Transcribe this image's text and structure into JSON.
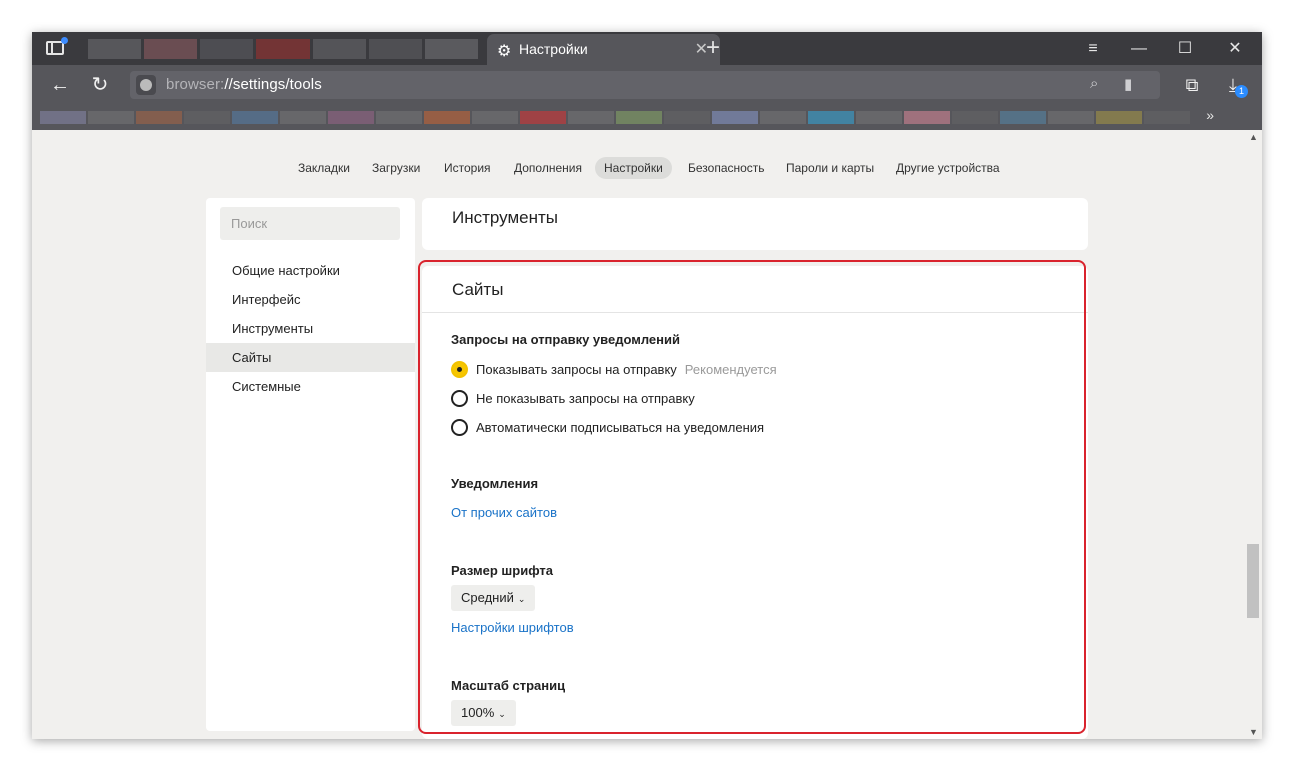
{
  "tab": {
    "title": "Настройки",
    "close": "✕",
    "new_tab": "+"
  },
  "window_controls": {
    "menu": "≡",
    "minimize": "—",
    "maximize": "☐",
    "close": "✕"
  },
  "address": {
    "scheme": "browser:",
    "path": "//settings/tools"
  },
  "downloads_badge": "1",
  "bookmarks_more": "»",
  "top_nav": [
    {
      "label": "Закладки"
    },
    {
      "label": "Загрузки"
    },
    {
      "label": "История"
    },
    {
      "label": "Дополнения"
    },
    {
      "label": "Настройки",
      "active": true
    },
    {
      "label": "Безопасность"
    },
    {
      "label": "Пароли и карты"
    },
    {
      "label": "Другие устройства"
    }
  ],
  "sidebar": {
    "search_placeholder": "Поиск",
    "items": [
      {
        "label": "Общие настройки"
      },
      {
        "label": "Интерфейс"
      },
      {
        "label": "Инструменты"
      },
      {
        "label": "Сайты",
        "active": true
      },
      {
        "label": "Системные"
      }
    ]
  },
  "tools_section": {
    "title": "Инструменты"
  },
  "sites_section": {
    "title": "Сайты",
    "notif_requests": {
      "title": "Запросы на отправку уведомлений",
      "options": [
        {
          "label": "Показывать запросы на отправку",
          "hint": "Рекомендуется",
          "selected": true
        },
        {
          "label": "Не показывать запросы на отправку",
          "hint": "",
          "selected": false
        },
        {
          "label": "Автоматически подписываться на уведомления",
          "hint": "",
          "selected": false
        }
      ]
    },
    "notifications": {
      "title": "Уведомления",
      "link": "От прочих сайтов"
    },
    "font_size": {
      "title": "Размер шрифта",
      "value": "Средний",
      "link": "Настройки шрифтов"
    },
    "page_zoom": {
      "title": "Масштаб страниц",
      "value": "100%"
    }
  },
  "colors": {
    "highlight": "#d9232d",
    "radio_selected": "#f7c600",
    "link": "#1a73c8"
  }
}
